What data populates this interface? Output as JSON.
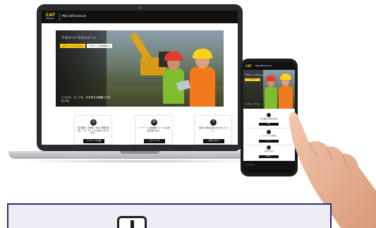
{
  "laptop": {
    "header": {
      "logo_text": "CAT",
      "logo_subtext": "Financial",
      "brand": "MyCatFinancial"
    },
    "hero": {
      "title": "アカウントマネジメント",
      "primary_button": "ログインしてください",
      "secondary_button": "アカウントを作成する",
      "caption": "いつでも、どこでも、お手持ちの機器でお支払いを。"
    },
    "cards": [
      {
        "icon": "clock-icon",
        "text": "取引履歴、請求書、支払い明細を確認し、オンラインでお支払いができます。",
        "button": "アカウントの詳細"
      },
      {
        "icon": "mail-icon",
        "text": "ペーパーレス請求書でメールに請求書が届きます。",
        "button": "ログインする"
      },
      {
        "icon": "question-icon",
        "text": "お困りの際はお問い合わせください。",
        "button": "お問い合わせ"
      }
    ]
  },
  "phone": {
    "header": {
      "logo_text": "CAT",
      "brand": "MyCatFinancial"
    },
    "hero": {
      "title": "アカウントマネジメント",
      "button": "ログイン",
      "caption": "いつでも、どこでも"
    },
    "sections": [
      {
        "text": "取引履歴と請求書を確認",
        "button": "詳細"
      },
      {
        "text": "ペーパーレス請求書",
        "button": "ログイン"
      },
      {
        "text": "お問い合わせ",
        "button": "連絡する"
      }
    ],
    "footer_text": "Cat Financial"
  },
  "colors": {
    "brand_yellow": "#ffcd11",
    "header_black": "#111111",
    "banner_border": "#2f2b6f",
    "banner_fill": "#eeecf4"
  }
}
